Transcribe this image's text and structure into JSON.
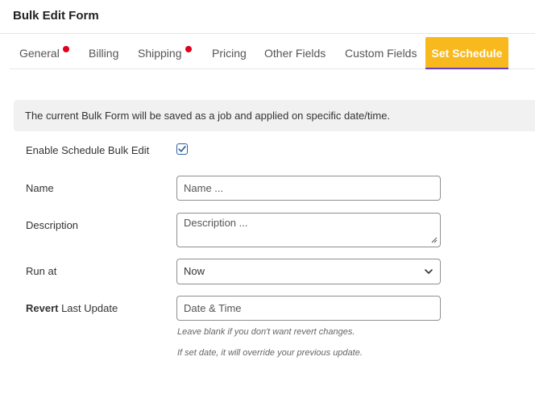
{
  "header": {
    "title": "Bulk Edit Form"
  },
  "tabs": [
    {
      "label": "General",
      "has_dot": true
    },
    {
      "label": "Billing",
      "has_dot": false
    },
    {
      "label": "Shipping",
      "has_dot": true
    },
    {
      "label": "Pricing",
      "has_dot": false
    },
    {
      "label": "Other Fields",
      "has_dot": false
    },
    {
      "label": "Custom Fields",
      "has_dot": false
    },
    {
      "label": "Set Schedule",
      "active": true
    }
  ],
  "notice": "The current Bulk Form will be saved as a job and applied on specific date/time.",
  "form": {
    "enable_label": "Enable Schedule Bulk Edit",
    "enable_checked": true,
    "name_label": "Name",
    "name_placeholder": "Name ...",
    "description_label": "Description",
    "description_placeholder": "Description ...",
    "run_at_label": "Run at",
    "run_at_value": "Now",
    "revert_label_bold": "Revert",
    "revert_label_rest": " Last Update",
    "revert_placeholder": "Date & Time",
    "hint_1": "Leave blank if you don't want revert changes.",
    "hint_2": "If set date, it will override your previous update."
  },
  "colors": {
    "active_tab_bg": "#f8b91e",
    "active_tab_underline": "#6a3fc9",
    "dot": "#e0001b",
    "checkbox": "#2a5f9e"
  },
  "icons": {
    "check": "checkmark-icon",
    "dropdown": "chevron-down-icon",
    "resize": "resize-handle-icon"
  }
}
